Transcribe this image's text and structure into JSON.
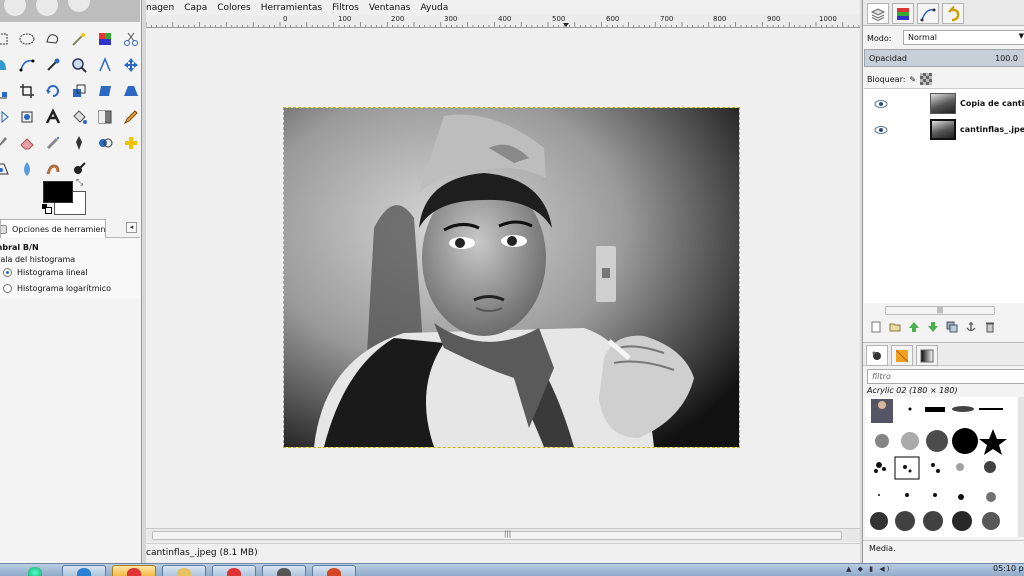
{
  "menubar": {
    "items": [
      "nagen",
      "Capa",
      "Colores",
      "Herramientas",
      "Filtros",
      "Ventanas",
      "Ayuda"
    ]
  },
  "ruler": {
    "ticks": [
      "0",
      "100",
      "200",
      "300",
      "400",
      "500",
      "600",
      "700",
      "800",
      "900",
      "1000"
    ]
  },
  "toolbox": {
    "tools": [
      "rect-select-icon",
      "ellipse-select-icon",
      "free-select-icon",
      "fuzzy-select-icon",
      "color-select-icon",
      "scissors-select-icon",
      "foreground-select-icon",
      "paths-icon",
      "color-picker-icon",
      "zoom-icon",
      "measure-icon",
      "move-icon",
      "align-icon",
      "crop-icon",
      "rotate-icon",
      "scale-icon",
      "shear-icon",
      "perspective-icon",
      "flip-icon",
      "cage-transform-icon",
      "text-icon",
      "bucket-fill-icon",
      "blend-icon",
      "pencil-icon",
      "paintbrush-icon",
      "eraser-icon",
      "airbrush-icon",
      "ink-icon",
      "clone-icon",
      "heal-icon",
      "perspective-clone-icon",
      "blur-icon",
      "smudge-icon",
      "dodge-burn-icon",
      "",
      ""
    ],
    "colors": {
      "foreground": "#000000",
      "background": "#ffffff"
    },
    "tab_label": "Opciones de herramienta",
    "options_title": "mbral B/N",
    "options_scale_label": "cala del histograma",
    "radio_linear": "Histograma lineal",
    "radio_log": "Histograma logarítmico"
  },
  "status": {
    "text": "cantinflas_.jpeg (8.1 MB)"
  },
  "dock": {
    "mode_label": "Modo:",
    "mode_value": "Normal",
    "opacity_label": "Opacidad",
    "opacity_value": "100.0",
    "lock_label": "Bloquear:",
    "layers": [
      {
        "name": "Copia de cantinfla",
        "visible": true
      },
      {
        "name": "cantinflas_.jpeg",
        "visible": true
      }
    ],
    "brush_filter_placeholder": "filtro",
    "brush_name": "Acrylic 02 (180 × 180)",
    "brush_view_label": "Media."
  },
  "taskbar": {
    "clock": "05:10 p"
  },
  "accent": {
    "selection": "#c7b400",
    "opacity_bar": "#c7d0d9",
    "taskbar": "#a9c0da"
  }
}
